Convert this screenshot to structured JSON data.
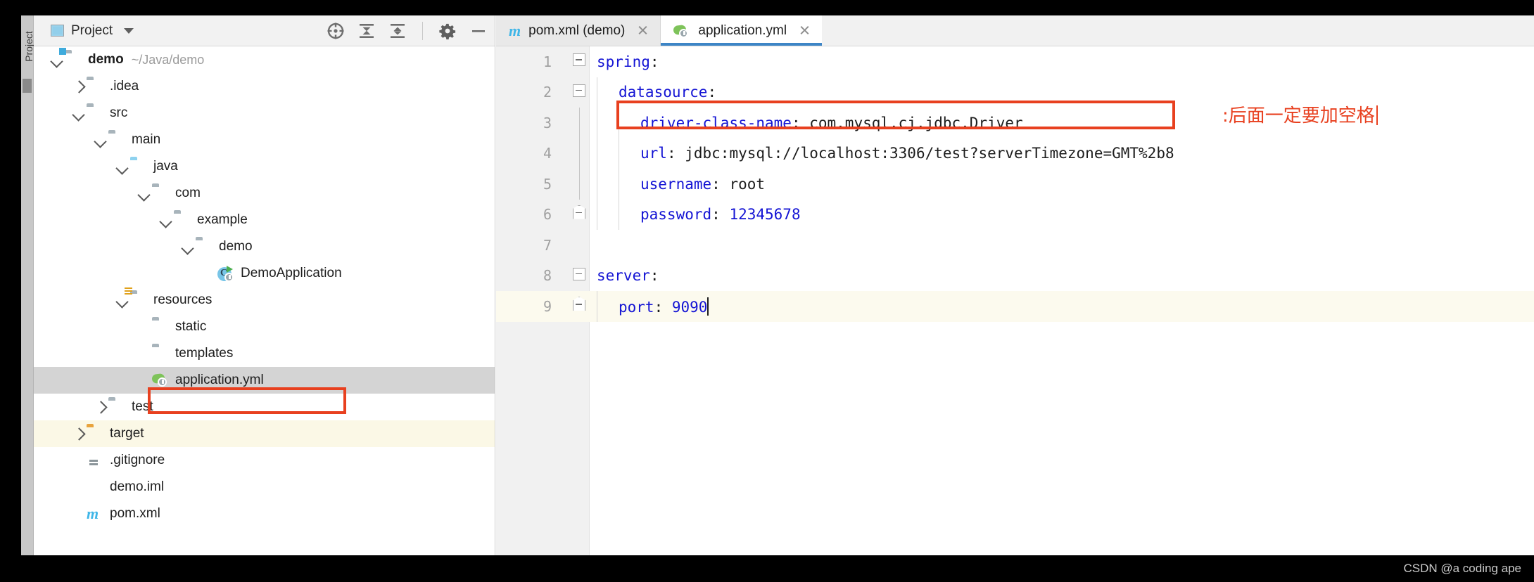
{
  "window": {
    "vertical_tab_label": "Project"
  },
  "project_panel": {
    "title": "Project",
    "title_icon": "project-window-icon",
    "dropdown_icon": "chevron-down-icon",
    "toolbar_icons": [
      {
        "name": "locate-crosshair-icon",
        "label": "Select Opened File"
      },
      {
        "name": "collapse-all-icon",
        "label": "Collapse All"
      },
      {
        "name": "expand-all-icon",
        "label": "Expand All"
      },
      {
        "name": "gear-icon",
        "label": "Settings"
      },
      {
        "name": "minimize-icon",
        "label": "Hide"
      }
    ],
    "tree": [
      {
        "label": "demo",
        "path": "~/Java/demo",
        "icon": "module-folder-icon",
        "arrow": "down",
        "depth": 0,
        "bold": true,
        "state": "normal"
      },
      {
        "label": ".idea",
        "path": "",
        "icon": "folder-icon",
        "arrow": "right",
        "depth": 1,
        "bold": false,
        "state": "normal"
      },
      {
        "label": "src",
        "path": "",
        "icon": "folder-icon",
        "arrow": "down",
        "depth": 1,
        "bold": false,
        "state": "normal"
      },
      {
        "label": "main",
        "path": "",
        "icon": "folder-icon",
        "arrow": "down",
        "depth": 2,
        "bold": false,
        "state": "normal"
      },
      {
        "label": "java",
        "path": "",
        "icon": "source-root-folder-icon",
        "arrow": "down",
        "depth": 3,
        "bold": false,
        "state": "normal"
      },
      {
        "label": "com",
        "path": "",
        "icon": "package-folder-icon",
        "arrow": "down",
        "depth": 4,
        "bold": false,
        "state": "normal"
      },
      {
        "label": "example",
        "path": "",
        "icon": "package-folder-icon",
        "arrow": "down",
        "depth": 5,
        "bold": false,
        "state": "normal"
      },
      {
        "label": "demo",
        "path": "",
        "icon": "package-folder-icon",
        "arrow": "down",
        "depth": 6,
        "bold": false,
        "state": "normal"
      },
      {
        "label": "DemoApplication",
        "path": "",
        "icon": "spring-boot-class-icon",
        "arrow": "none",
        "depth": 7,
        "bold": false,
        "state": "normal"
      },
      {
        "label": "resources",
        "path": "",
        "icon": "resources-folder-icon",
        "arrow": "down",
        "depth": 3,
        "bold": false,
        "state": "normal"
      },
      {
        "label": "static",
        "path": "",
        "icon": "folder-icon",
        "arrow": "none",
        "depth": 4,
        "bold": false,
        "state": "normal"
      },
      {
        "label": "templates",
        "path": "",
        "icon": "folder-icon",
        "arrow": "none",
        "depth": 4,
        "bold": false,
        "state": "normal"
      },
      {
        "label": "application.yml",
        "path": "",
        "icon": "yaml-spring-file-icon",
        "arrow": "none",
        "depth": 4,
        "bold": false,
        "state": "selected"
      },
      {
        "label": "test",
        "path": "",
        "icon": "folder-icon",
        "arrow": "right",
        "depth": 2,
        "bold": false,
        "state": "normal"
      },
      {
        "label": "target",
        "path": "",
        "icon": "target-folder-icon",
        "arrow": "right",
        "depth": 1,
        "bold": false,
        "state": "excluded"
      },
      {
        "label": ".gitignore",
        "path": "",
        "icon": "gitignore-file-icon",
        "arrow": "none",
        "depth": 1,
        "bold": false,
        "state": "normal"
      },
      {
        "label": "demo.iml",
        "path": "",
        "icon": "iml-file-icon",
        "arrow": "none",
        "depth": 1,
        "bold": false,
        "state": "normal"
      },
      {
        "label": "pom.xml",
        "path": "",
        "icon": "maven-file-icon",
        "arrow": "none",
        "depth": 1,
        "bold": false,
        "state": "normal"
      }
    ]
  },
  "editor": {
    "tabs": [
      {
        "label": "pom.xml (demo)",
        "icon": "maven-file-icon",
        "active": false,
        "close_icon": "close-icon"
      },
      {
        "label": "application.yml",
        "icon": "yaml-spring-file-icon",
        "active": true,
        "close_icon": "close-icon"
      }
    ],
    "lines": [
      {
        "num": "1",
        "indent": 0,
        "fold": "minus",
        "key": "spring",
        "sep": ":",
        "value": "",
        "current": false
      },
      {
        "num": "2",
        "indent": 1,
        "fold": "minus",
        "key": "datasource",
        "sep": ":",
        "value": "",
        "current": false
      },
      {
        "num": "3",
        "indent": 2,
        "fold": "line",
        "key": "driver-class-name",
        "sep": ": ",
        "value": "com.mysql.cj.jdbc.Driver",
        "current": false
      },
      {
        "num": "4",
        "indent": 2,
        "fold": "line",
        "key": "url",
        "sep": ": ",
        "value": "jdbc:mysql://localhost:3306/test?serverTimezone=GMT%2b8",
        "current": false
      },
      {
        "num": "5",
        "indent": 2,
        "fold": "line",
        "key": "username",
        "sep": ": ",
        "value": "root",
        "current": false
      },
      {
        "num": "6",
        "indent": 2,
        "fold": "end",
        "key": "password",
        "sep": ": ",
        "value": "12345678",
        "current": false
      },
      {
        "num": "7",
        "indent": 0,
        "fold": "none",
        "key": "",
        "sep": "",
        "value": "",
        "current": false
      },
      {
        "num": "8",
        "indent": 0,
        "fold": "minus",
        "key": "server",
        "sep": ":",
        "value": "",
        "current": false
      },
      {
        "num": "9",
        "indent": 1,
        "fold": "end",
        "key": "port",
        "sep": ": ",
        "value": "9090",
        "current": true,
        "caret": true
      }
    ]
  },
  "annotation": {
    "text": ":后面一定要加空格",
    "color": "#e8401f"
  },
  "watermark": {
    "text": "CSDN @a coding ape"
  },
  "colors": {
    "yaml_key": "#1414d4",
    "yaml_value": "#1d1d1d",
    "annotation_red": "#e8401f",
    "active_tab_underline": "#3d85c6",
    "selection_grey": "#d4d4d4",
    "current_line": "#fcfaee"
  }
}
